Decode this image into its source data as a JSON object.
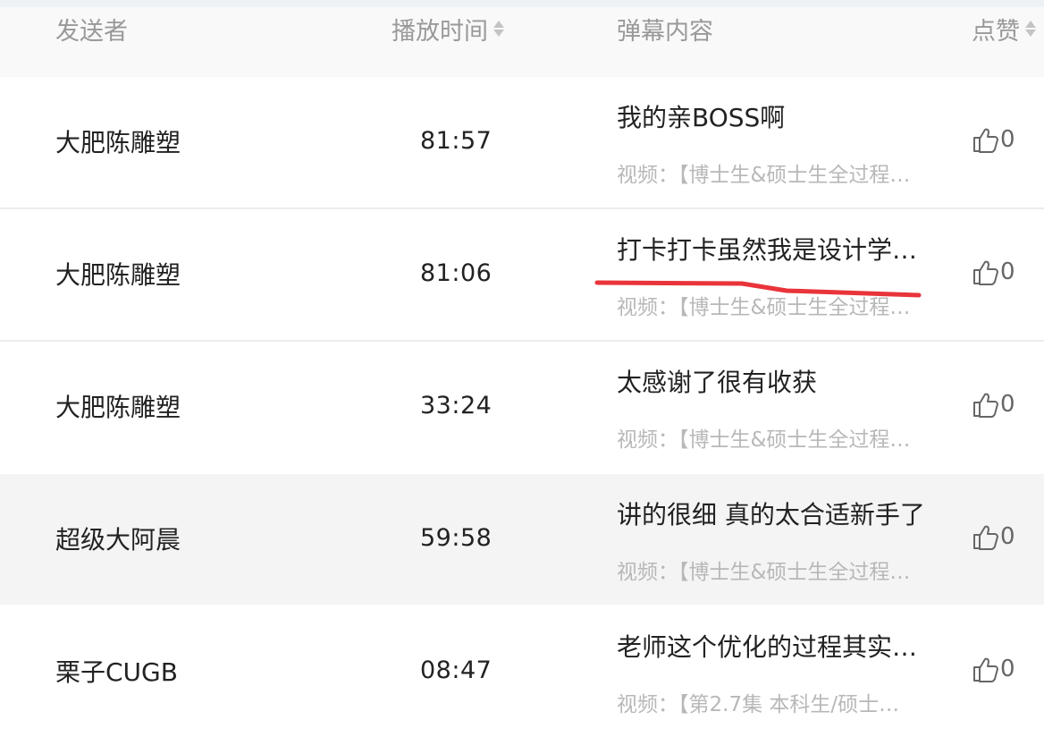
{
  "table": {
    "headers": {
      "sender": "发送者",
      "time": "播放时间",
      "content": "弹幕内容",
      "likes": "点赞"
    },
    "rows": [
      {
        "sender": "大肥陈雕塑",
        "time": "81:57",
        "content": "我的亲BOSS啊",
        "video": "视频：【博士生&硕士生全过程…",
        "likes": "0",
        "highlighted": false
      },
      {
        "sender": "大肥陈雕塑",
        "time": "81:06",
        "content": "打卡打卡虽然我是设计学…",
        "video": "视频：【博士生&硕士生全过程…",
        "likes": "0",
        "highlighted": false
      },
      {
        "sender": "大肥陈雕塑",
        "time": "33:24",
        "content": "太感谢了很有收获",
        "video": "视频：【博士生&硕士生全过程…",
        "likes": "0",
        "highlighted": false
      },
      {
        "sender": "超级大阿晨",
        "time": "59:58",
        "content": "讲的很细 真的太合适新手了",
        "video": "视频：【博士生&硕士生全过程…",
        "likes": "0",
        "highlighted": true
      },
      {
        "sender": "栗子CUGB",
        "time": "08:47",
        "content": "老师这个优化的过程其实…",
        "video": "视频：【第2.7集 本科生/硕士…",
        "likes": "0",
        "highlighted": false
      }
    ]
  },
  "colors": {
    "header_bg": "#f9f9f9",
    "header_text": "#999999",
    "row_highlight": "#f4f4f4",
    "annotation_line": "#e8343a"
  },
  "icons": {
    "like": "thumbs-up-icon",
    "sort": "sort-icon"
  }
}
